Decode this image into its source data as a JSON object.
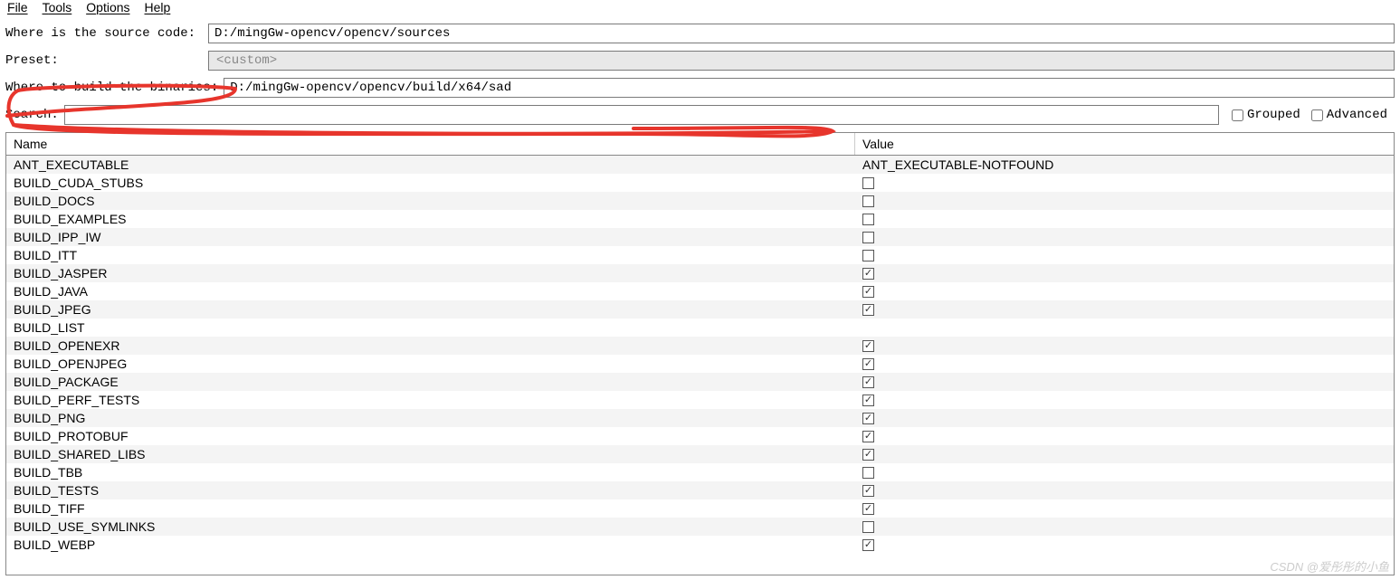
{
  "menubar": {
    "items": [
      "File",
      "Tools",
      "Options",
      "Help"
    ]
  },
  "form": {
    "source_label": "Where is the source code:",
    "source_value": "D:/mingGw-opencv/opencv/sources",
    "preset_label": "Preset:",
    "preset_value": "<custom>",
    "build_label": "Where to build the binaries:",
    "build_value": "D:/mingGw-opencv/opencv/build/x64/sad",
    "search_label": "Search:",
    "search_value": "",
    "grouped_label": "Grouped",
    "advanced_label": "Advanced"
  },
  "table": {
    "headers": {
      "name": "Name",
      "value": "Value"
    },
    "rows": [
      {
        "name": "ANT_EXECUTABLE",
        "type": "text",
        "value": "ANT_EXECUTABLE-NOTFOUND"
      },
      {
        "name": "BUILD_CUDA_STUBS",
        "type": "bool",
        "checked": false
      },
      {
        "name": "BUILD_DOCS",
        "type": "bool",
        "checked": false
      },
      {
        "name": "BUILD_EXAMPLES",
        "type": "bool",
        "checked": false
      },
      {
        "name": "BUILD_IPP_IW",
        "type": "bool",
        "checked": false
      },
      {
        "name": "BUILD_ITT",
        "type": "bool",
        "checked": false
      },
      {
        "name": "BUILD_JASPER",
        "type": "bool",
        "checked": true
      },
      {
        "name": "BUILD_JAVA",
        "type": "bool",
        "checked": true
      },
      {
        "name": "BUILD_JPEG",
        "type": "bool",
        "checked": true
      },
      {
        "name": "BUILD_LIST",
        "type": "text",
        "value": ""
      },
      {
        "name": "BUILD_OPENEXR",
        "type": "bool",
        "checked": true
      },
      {
        "name": "BUILD_OPENJPEG",
        "type": "bool",
        "checked": true
      },
      {
        "name": "BUILD_PACKAGE",
        "type": "bool",
        "checked": true
      },
      {
        "name": "BUILD_PERF_TESTS",
        "type": "bool",
        "checked": true
      },
      {
        "name": "BUILD_PNG",
        "type": "bool",
        "checked": true
      },
      {
        "name": "BUILD_PROTOBUF",
        "type": "bool",
        "checked": true
      },
      {
        "name": "BUILD_SHARED_LIBS",
        "type": "bool",
        "checked": true
      },
      {
        "name": "BUILD_TBB",
        "type": "bool",
        "checked": false
      },
      {
        "name": "BUILD_TESTS",
        "type": "bool",
        "checked": true
      },
      {
        "name": "BUILD_TIFF",
        "type": "bool",
        "checked": true
      },
      {
        "name": "BUILD_USE_SYMLINKS",
        "type": "bool",
        "checked": false
      },
      {
        "name": "BUILD_WEBP",
        "type": "bool",
        "checked": true
      }
    ]
  },
  "watermark": "CSDN @爱彤彤的小鱼"
}
